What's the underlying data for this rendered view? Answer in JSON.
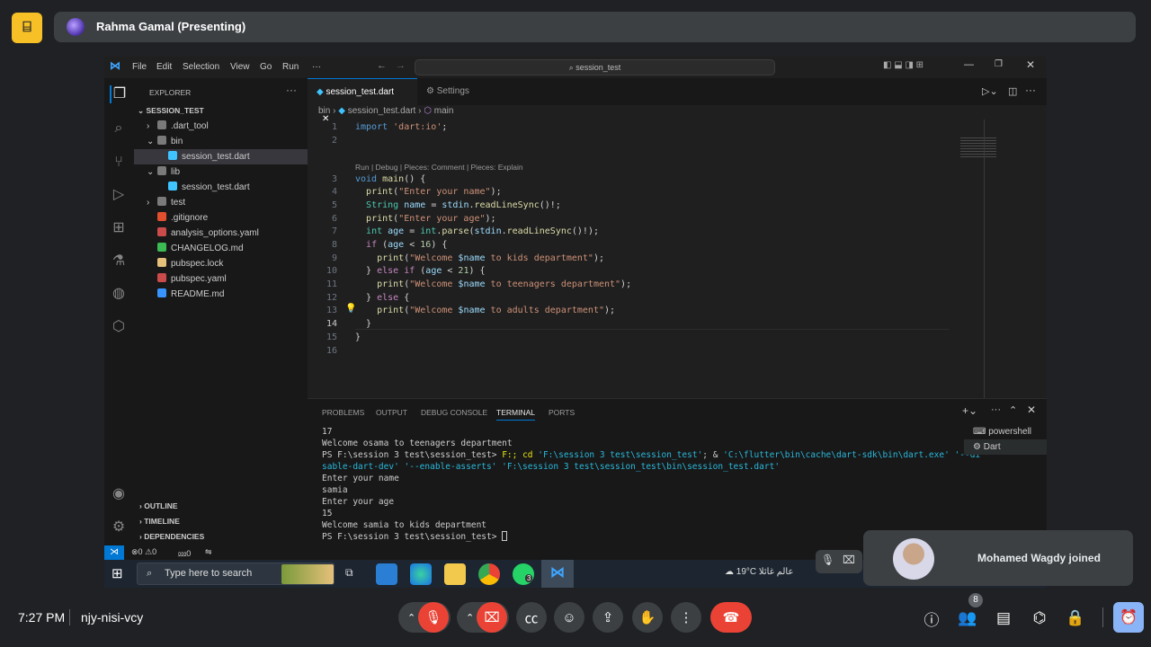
{
  "meet": {
    "presenter": "Rahma Gamal (Presenting)",
    "clock": "7:27 PM",
    "meeting_code": "njy-nisi-vcy",
    "toast": "Mohamed Wagdy joined",
    "people_count": "8",
    "colors": {
      "end_call": "#ea4335",
      "activities": "#8ab4f8"
    }
  },
  "vscode": {
    "menu": [
      "File",
      "Edit",
      "Selection",
      "View",
      "Go",
      "Run",
      "···"
    ],
    "command_center": "session_test",
    "explorer_title": "EXPLORER",
    "project": "SESSION_TEST",
    "tree": [
      {
        "label": ".dart_tool",
        "kind": "folder",
        "chev": "›"
      },
      {
        "label": "bin",
        "kind": "folder-open",
        "chev": "⌄"
      },
      {
        "label": "session_test.dart",
        "kind": "dart"
      },
      {
        "label": "lib",
        "kind": "folder-open",
        "chev": "⌄"
      },
      {
        "label": "session_test.dart",
        "kind": "dart"
      },
      {
        "label": "test",
        "kind": "folder",
        "chev": "›"
      },
      {
        "label": ".gitignore",
        "kind": "git"
      },
      {
        "label": "analysis_options.yaml",
        "kind": "yaml"
      },
      {
        "label": "CHANGELOG.md",
        "kind": "changelog"
      },
      {
        "label": "pubspec.lock",
        "kind": "lock"
      },
      {
        "label": "pubspec.yaml",
        "kind": "pubspec"
      },
      {
        "label": "README.md",
        "kind": "info"
      }
    ],
    "sidebar_sections": [
      "OUTLINE",
      "TIMELINE",
      "DEPENDENCIES"
    ],
    "tabs": {
      "active": "session_test.dart",
      "second": "Settings"
    },
    "breadcrumb": [
      "bin",
      "session_test.dart",
      "main"
    ],
    "codelens": "Run | Debug | Pieces: Comment | Pieces: Explain",
    "line_numbers": [
      "1",
      "2",
      "3",
      "4",
      "5",
      "6",
      "7",
      "8",
      "9",
      "10",
      "11",
      "12",
      "13",
      "14",
      "15",
      "16"
    ],
    "panel_tabs": [
      "PROBLEMS",
      "OUTPUT",
      "DEBUG CONSOLE",
      "TERMINAL",
      "PORTS"
    ],
    "terminal_lines": [
      "17",
      "Welcome osama to teenagers department",
      "Enter your name",
      "samia",
      "Enter your age",
      "15",
      "Welcome samia to kids department",
      "PS F:\\session 3 test\\session_test> "
    ],
    "terminal_cmd": {
      "prompt": "PS F:\\session 3 test\\session_test> ",
      "cmd1": "F:; cd ",
      "arg1": "'F:\\session 3 test\\session_test'",
      "amp": "; & ",
      "arg2": "'C:\\flutter\\bin\\cache\\dart-sdk\\bin\\dart.exe' '--di",
      "cont": "sable-dart-dev' '--enable-asserts' 'F:\\session 3 test\\session_test\\bin\\session_test.dart'"
    },
    "terminals": [
      "powershell",
      "Dart"
    ],
    "status": {
      "errors": "0",
      "warnings": "0",
      "ports": "0"
    }
  },
  "taskbar": {
    "search_placeholder": "Type here to search",
    "weather": "19°C  عالم غائلا",
    "whatsapp_badge": "3"
  }
}
